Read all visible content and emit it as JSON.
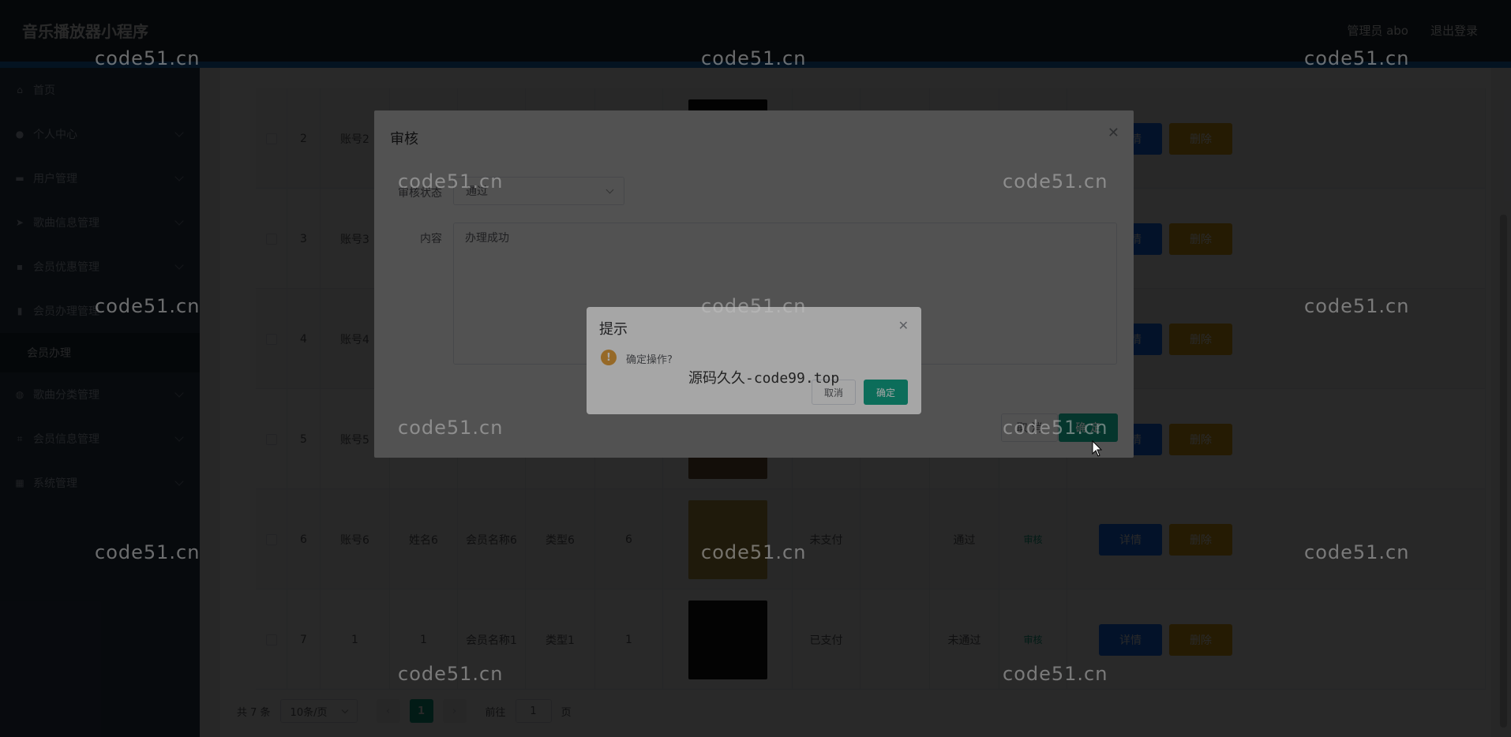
{
  "header": {
    "title": "音乐播放器小程序",
    "user": "管理员 abo",
    "logout": "退出登录"
  },
  "sidebar": {
    "items": [
      {
        "label": "首页",
        "icon": "home-icon"
      },
      {
        "label": "个人中心",
        "icon": "user-icon"
      },
      {
        "label": "用户管理",
        "icon": "users-icon"
      },
      {
        "label": "歌曲信息管理",
        "icon": "send-icon"
      },
      {
        "label": "会员优惠管理",
        "icon": "message-icon"
      },
      {
        "label": "会员办理管理",
        "icon": "clipboard-icon"
      },
      {
        "label": "歌曲分类管理",
        "icon": "globe-icon"
      },
      {
        "label": "会员信息管理",
        "icon": "crop-icon"
      },
      {
        "label": "系统管理",
        "icon": "grid-icon"
      }
    ],
    "submenu": "会员办理"
  },
  "table": {
    "rows": [
      {
        "idx": "2",
        "account": "账号2",
        "name": "",
        "member_name": "",
        "type": "",
        "count": "",
        "pay": "",
        "status": "",
        "thumb_color": "#111111"
      },
      {
        "idx": "3",
        "account": "账号3",
        "name": "",
        "member_name": "",
        "type": "",
        "count": "",
        "pay": "",
        "status": "",
        "thumb_color": "#333333"
      },
      {
        "idx": "4",
        "account": "账号4",
        "name": "",
        "member_name": "",
        "type": "",
        "count": "",
        "pay": "",
        "status": "",
        "thumb_color": "#222222"
      },
      {
        "idx": "5",
        "account": "账号5",
        "name": "",
        "member_name": "",
        "type": "",
        "count": "",
        "pay": "",
        "status": "",
        "thumb_color": "#7a5a38"
      },
      {
        "idx": "6",
        "account": "账号6",
        "name": "姓名6",
        "member_name": "会员名称6",
        "type": "类型6",
        "count": "6",
        "pay": "未支付",
        "status": "通过",
        "thumb_color": "#c7a24a"
      },
      {
        "idx": "7",
        "account": "1",
        "name": "1",
        "member_name": "会员名称1",
        "type": "类型1",
        "count": "1",
        "pay": "已支付",
        "status": "未通过",
        "thumb_color": "#1a1a1a"
      }
    ],
    "audit_label": "审核",
    "detail_label": "详情",
    "delete_label": "删除"
  },
  "pager": {
    "total": "共 7 条",
    "page_size": "10条/页",
    "current": "1",
    "goto_prefix": "前往",
    "goto_value": "1",
    "goto_suffix": "页"
  },
  "audit_dialog": {
    "title": "审核",
    "status_label": "审核状态",
    "status_value": "通过",
    "content_label": "内容",
    "content_value": "办理成功",
    "cancel": "取 消",
    "ok": "确 定"
  },
  "confirm": {
    "title": "提示",
    "message": "确定操作?",
    "cancel": "取消",
    "ok": "确定"
  },
  "watermark": "code51.cn",
  "overlay_text": "源码久久-code99.top"
}
